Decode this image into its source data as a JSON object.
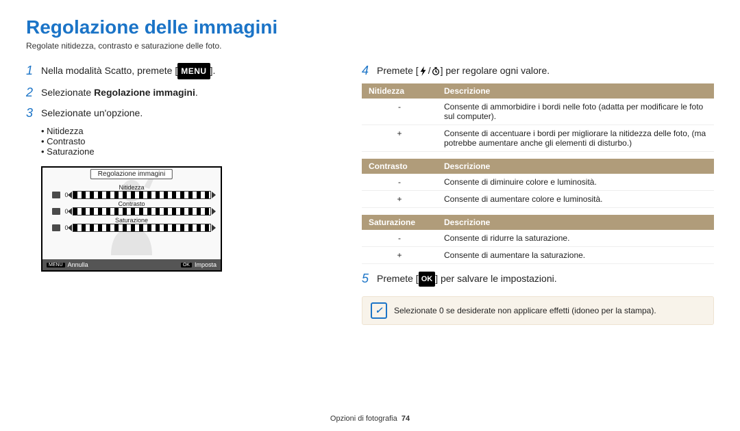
{
  "title": "Regolazione delle immagini",
  "subtitle": "Regolate nitidezza, contrasto e saturazione delle foto.",
  "left": {
    "steps": [
      {
        "n": "1",
        "prefix": "Nella modalità Scatto, premete [",
        "badge": "MENU",
        "suffix": "]."
      },
      {
        "n": "2",
        "prefix": "Selezionate ",
        "bold": "Regolazione immagini",
        "suffix": "."
      },
      {
        "n": "3",
        "prefix": "Selezionate un'opzione."
      }
    ],
    "options": [
      "Nitidezza",
      "Contrasto",
      "Saturazione"
    ],
    "lcd": {
      "title": "Regolazione immagini",
      "rows": [
        {
          "label": "Nitidezza",
          "value": "0"
        },
        {
          "label": "Contrasto",
          "value": "0"
        },
        {
          "label": "Saturazione",
          "value": "0"
        }
      ],
      "footer": {
        "left_badge": "MENU",
        "left": "Annulla",
        "right_badge": "OK",
        "right": "Imposta"
      }
    }
  },
  "right": {
    "step4": {
      "n": "4",
      "prefix": "Premete [",
      "suffix": "] per regolare ogni valore."
    },
    "tables": [
      {
        "h1": "Nitidezza",
        "h2": "Descrizione",
        "rows": [
          {
            "sym": "-",
            "txt": "Consente di ammorbidire i bordi nelle foto (adatta per modificare le foto sul computer)."
          },
          {
            "sym": "+",
            "txt": "Consente di accentuare i bordi per migliorare la nitidezza delle foto, (ma potrebbe aumentare anche gli elementi di disturbo.)"
          }
        ]
      },
      {
        "h1": "Contrasto",
        "h2": "Descrizione",
        "rows": [
          {
            "sym": "-",
            "txt": "Consente di diminuire colore e luminosità."
          },
          {
            "sym": "+",
            "txt": "Consente di aumentare colore e luminosità."
          }
        ]
      },
      {
        "h1": "Saturazione",
        "h2": "Descrizione",
        "rows": [
          {
            "sym": "-",
            "txt": "Consente di ridurre la saturazione."
          },
          {
            "sym": "+",
            "txt": "Consente di aumentare la saturazione."
          }
        ]
      }
    ],
    "step5": {
      "n": "5",
      "prefix": "Premete [",
      "badge": "OK",
      "suffix": "] per salvare le impostazioni."
    },
    "note": "Selezionate 0 se desiderate non applicare effetti (idoneo per la stampa)."
  },
  "footer": {
    "section": "Opzioni di fotografia",
    "page": "74"
  }
}
